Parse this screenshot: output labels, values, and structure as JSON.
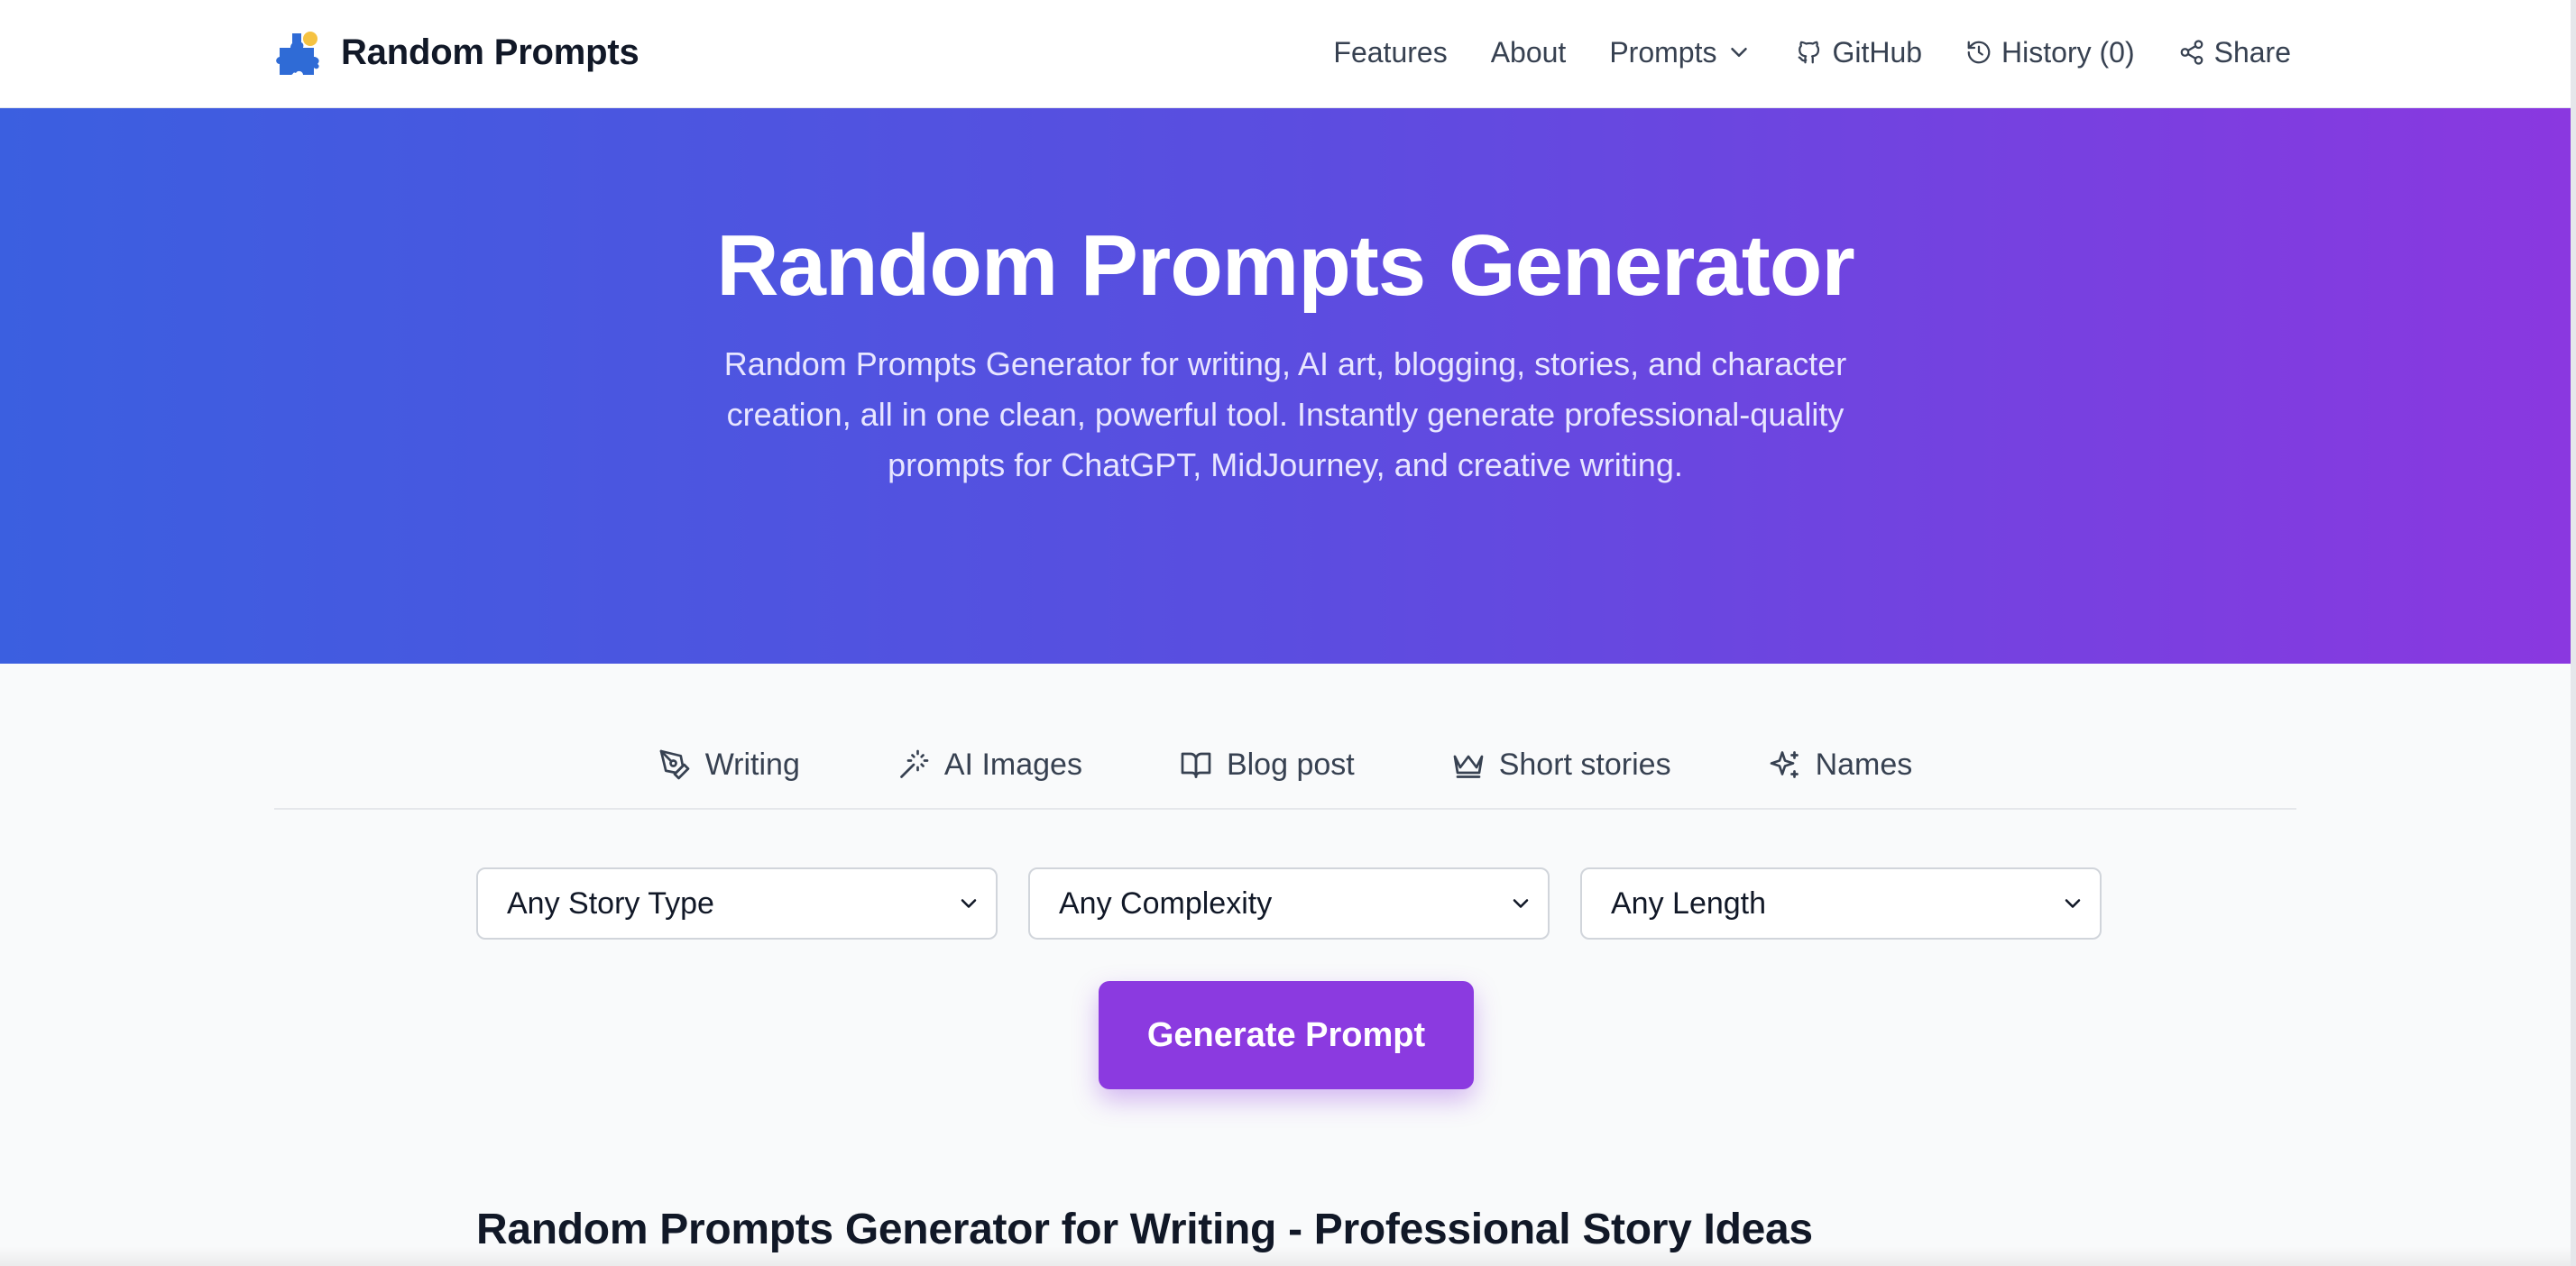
{
  "brand": {
    "title": "Random Prompts",
    "logo_icon": "puzzle-icon"
  },
  "nav": {
    "features": "Features",
    "about": "About",
    "prompts": "Prompts",
    "github": "GitHub",
    "history": "History (0)",
    "share": "Share"
  },
  "hero": {
    "title": "Random Prompts Generator",
    "subtitle": "Random Prompts Generator for writing, AI art, blogging, stories, and character creation, all in one clean, powerful tool. Instantly generate professional-quality prompts for ChatGPT, MidJourney, and creative writing."
  },
  "tabs": [
    {
      "label": "Writing",
      "icon": "pen-icon"
    },
    {
      "label": "AI Images",
      "icon": "magic-wand-icon"
    },
    {
      "label": "Blog post",
      "icon": "book-icon"
    },
    {
      "label": "Short stories",
      "icon": "crown-icon"
    },
    {
      "label": "Names",
      "icon": "sparkles-icon"
    }
  ],
  "filters": {
    "story_type": "Any Story Type",
    "complexity": "Any Complexity",
    "length": "Any Length"
  },
  "actions": {
    "generate": "Generate Prompt"
  },
  "section": {
    "title": "Random Prompts Generator for Writing - Professional Story Ideas"
  },
  "colors": {
    "hero_gradient_start": "#3b5fe0",
    "hero_gradient_end": "#8a38e0",
    "button": "#8b3ae0",
    "logo_blue": "#2f6bd6",
    "logo_yellow": "#f5c242"
  }
}
